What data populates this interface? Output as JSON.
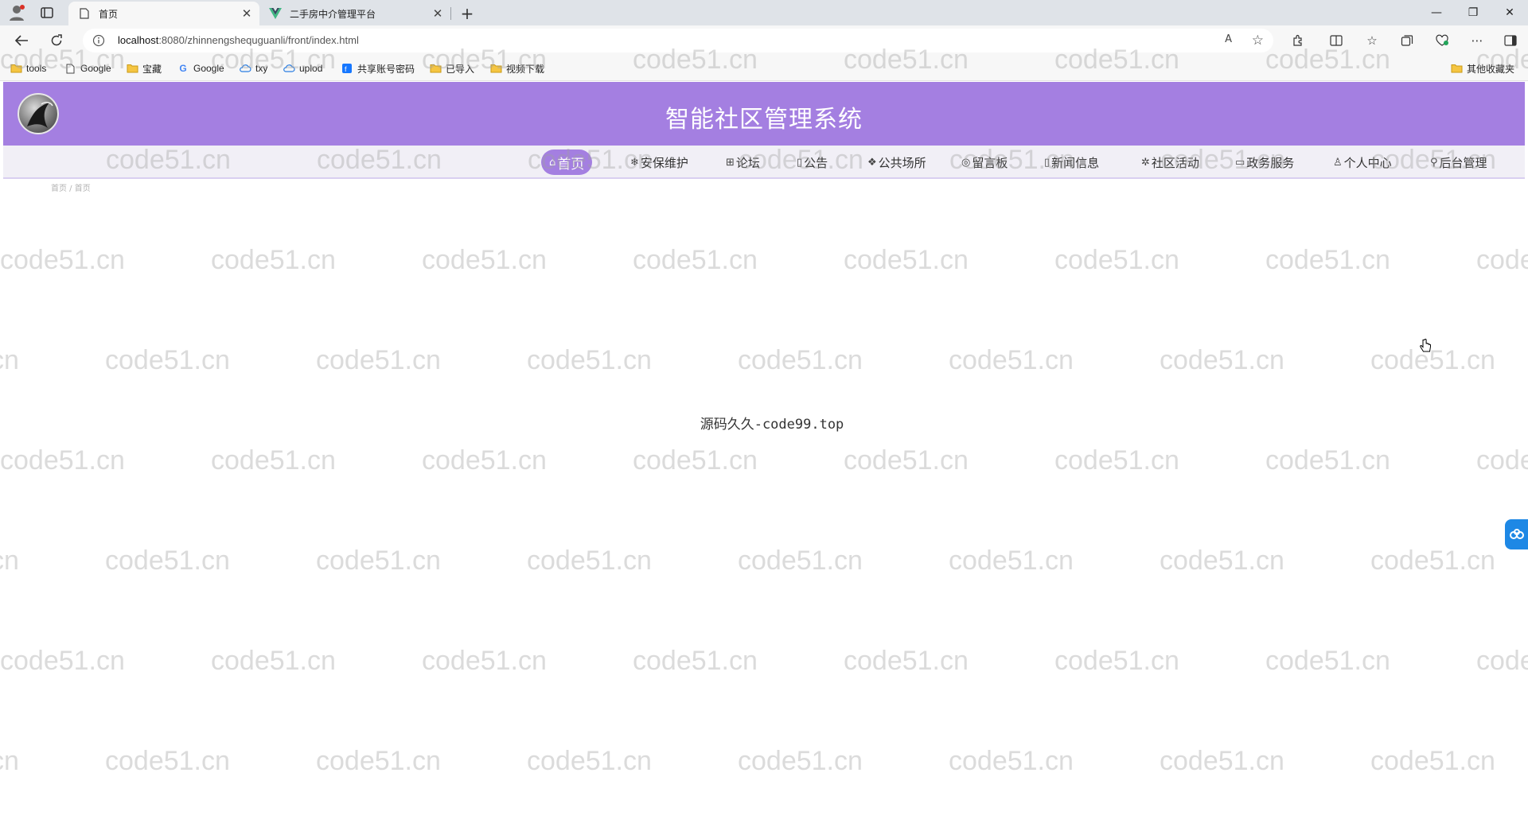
{
  "browser": {
    "tabs": [
      {
        "title": "首页",
        "active": true
      },
      {
        "title": "二手房中介管理平台",
        "active": false
      }
    ],
    "new_tab_icon": "plus-icon",
    "window_controls": {
      "minimize": "—",
      "restore": "❐",
      "close": "✕"
    },
    "url_host": "localhost",
    "url_rest": ":8080/zhinnengshequguanli/front/index.html",
    "read_aloud": "A",
    "bookmarks": [
      {
        "label": "tools",
        "icon": "folder-icon"
      },
      {
        "label": "Google",
        "icon": "page-icon"
      },
      {
        "label": "宝藏",
        "icon": "folder-icon"
      },
      {
        "label": "Google",
        "icon": "google-icon"
      },
      {
        "label": "txy",
        "icon": "cloud-icon"
      },
      {
        "label": "uplod",
        "icon": "cloud-icon"
      },
      {
        "label": "共享账号密码",
        "icon": "app-icon"
      },
      {
        "label": "已导入",
        "icon": "folder-icon"
      },
      {
        "label": "视频下载",
        "icon": "folder-icon"
      }
    ],
    "other_bookmarks": "其他收藏夹"
  },
  "site": {
    "title": "智能社区管理系统",
    "accent_color": "#a47fe1",
    "nav": [
      {
        "label": "首页",
        "icon": "⌂",
        "active": true
      },
      {
        "label": "安保维护",
        "icon": "❄",
        "active": false
      },
      {
        "label": "论坛",
        "icon": "⊞",
        "active": false
      },
      {
        "label": "公告",
        "icon": "▯",
        "active": false
      },
      {
        "label": "公共场所",
        "icon": "❖",
        "active": false
      },
      {
        "label": "留言板",
        "icon": "◎",
        "active": false
      },
      {
        "label": "新闻信息",
        "icon": "▯",
        "active": false
      },
      {
        "label": "社区活动",
        "icon": "✲",
        "active": false
      },
      {
        "label": "政务服务",
        "icon": "▭",
        "active": false
      },
      {
        "label": "个人中心",
        "icon": "♙",
        "active": false
      },
      {
        "label": "后台管理",
        "icon": "⚲",
        "active": false
      }
    ],
    "breadcrumb": "首页 / 首页",
    "source_text": "源码久久-code99.top"
  },
  "watermark": "code51.cn"
}
